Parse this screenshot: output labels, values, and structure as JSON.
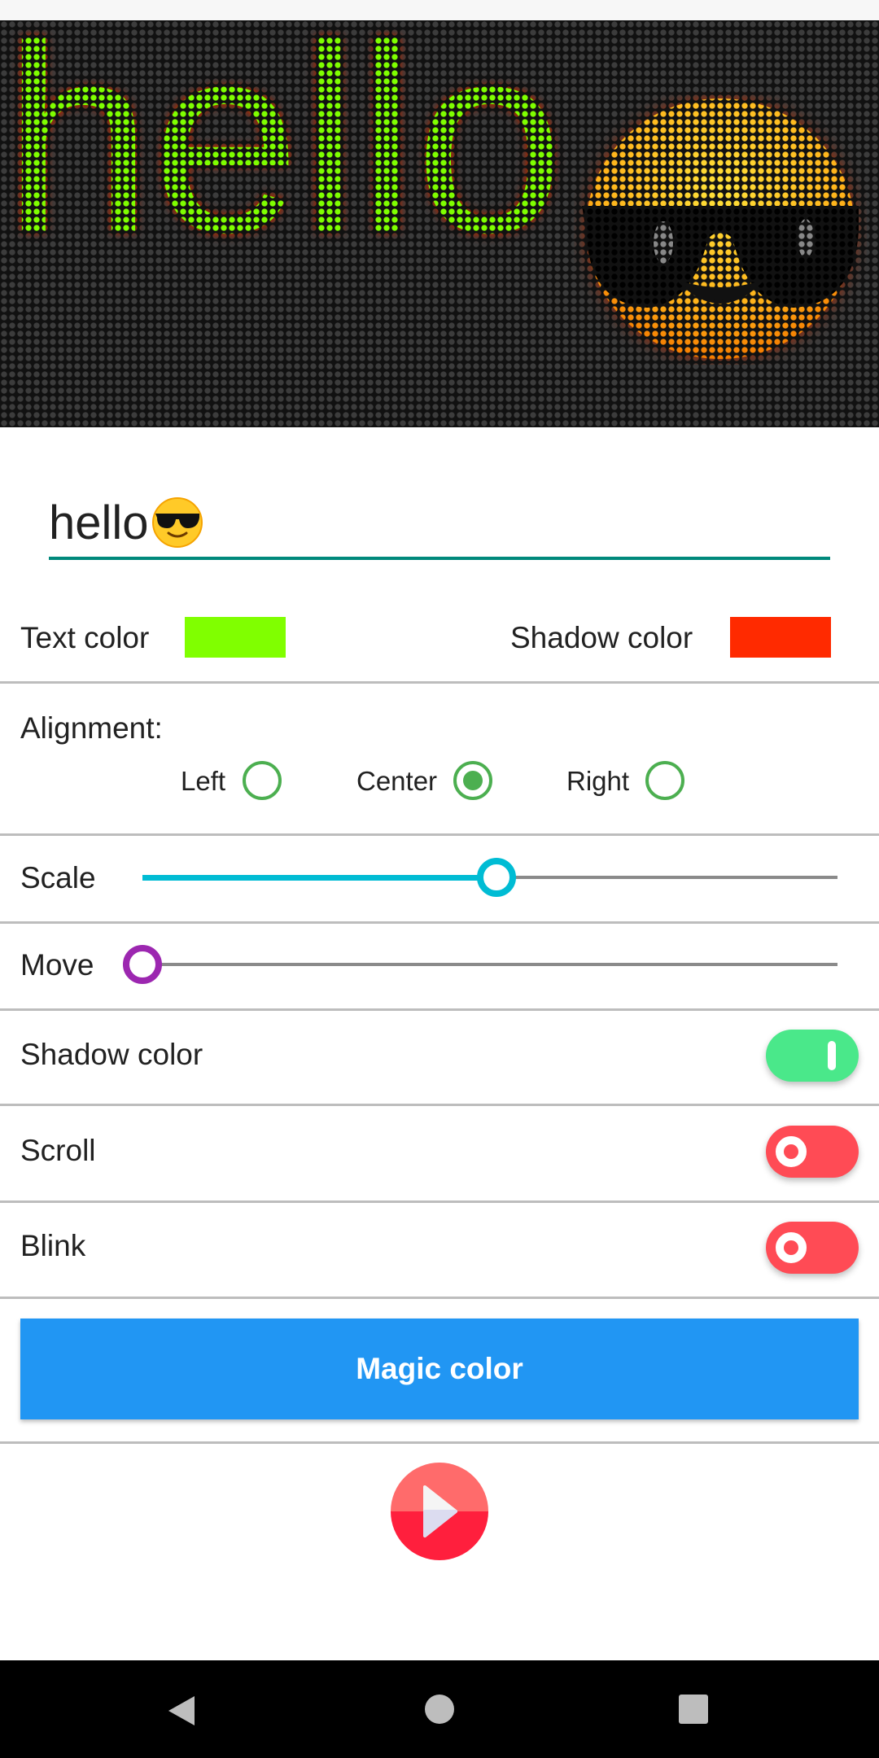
{
  "preview": {
    "text": "hello",
    "emoji_icon": "smiling-face-with-sunglasses-icon",
    "text_color": "#7fff00",
    "shadow_color": "#ff2a00"
  },
  "input": {
    "value": "hello",
    "emoji_icon": "smiling-face-with-sunglasses-icon"
  },
  "colors": {
    "text_color_label": "Text color",
    "text_color_value": "#80ff00",
    "shadow_color_label": "Shadow color",
    "shadow_color_value": "#ff2a00"
  },
  "alignment": {
    "label": "Alignment:",
    "options": [
      {
        "label": "Left",
        "selected": false
      },
      {
        "label": "Center",
        "selected": true
      },
      {
        "label": "Right",
        "selected": false
      }
    ]
  },
  "scale": {
    "label": "Scale",
    "value_percent": 51,
    "color": "#00bcd4"
  },
  "move": {
    "label": "Move",
    "value_percent": 0,
    "color": "#9c27b0"
  },
  "toggles": [
    {
      "label": "Shadow color",
      "on": true,
      "color": "#4ae88a"
    },
    {
      "label": "Scroll",
      "on": false,
      "color": "#ff4b55"
    },
    {
      "label": "Blink",
      "on": false,
      "color": "#ff4b55"
    }
  ],
  "magic_button": {
    "label": "Magic color",
    "color": "#2196f3"
  },
  "play_icon": "play-icon",
  "nav": [
    "back-icon",
    "home-icon",
    "recents-icon"
  ]
}
